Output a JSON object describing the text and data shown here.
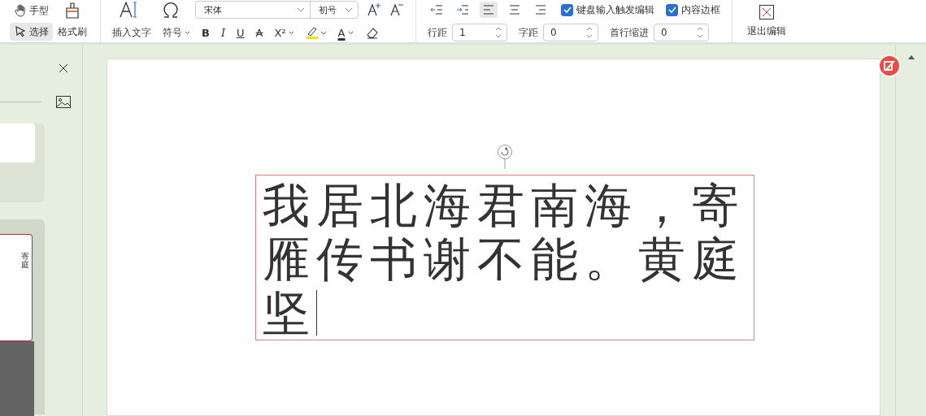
{
  "toolbar": {
    "modes": [
      {
        "label": "手型",
        "selected": false,
        "kind": "hand"
      },
      {
        "label": "选择",
        "selected": true,
        "kind": "pointer"
      }
    ],
    "format_painter": "格式刷",
    "insert_text": "插入文字",
    "symbol": "符号",
    "font_family": "宋体",
    "font_size": "初号",
    "styles": [
      {
        "kind": "bold",
        "label": "B"
      },
      {
        "kind": "italic",
        "label": "I"
      },
      {
        "kind": "underline",
        "label": "U"
      },
      {
        "kind": "strike",
        "label": "A"
      },
      {
        "kind": "super",
        "label": "X²"
      },
      {
        "kind": "highlight"
      },
      {
        "kind": "color",
        "label": "A"
      },
      {
        "kind": "eraser"
      }
    ],
    "alignment": [
      {
        "kind": "outdent",
        "selected": false
      },
      {
        "kind": "indent",
        "selected": false
      },
      {
        "kind": "left",
        "selected": true
      },
      {
        "kind": "center",
        "selected": false
      },
      {
        "kind": "right",
        "selected": false
      }
    ],
    "checkboxes": [
      {
        "label": "键盘输入触发编辑",
        "checked": true
      },
      {
        "label": "内容边框",
        "checked": true
      }
    ],
    "spinners": [
      {
        "label": "行距",
        "value": "1"
      },
      {
        "label": "字距",
        "value": "0"
      },
      {
        "label": "首行缩进",
        "value": "0"
      }
    ],
    "exit": "退出编辑"
  },
  "thumbnail": {
    "lines": [
      "寄",
      "庭"
    ]
  },
  "text_box": {
    "text": "我居北海君南海，寄雁传书谢不能。黄庭坚"
  }
}
